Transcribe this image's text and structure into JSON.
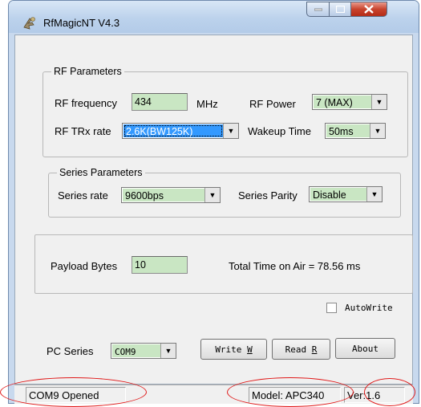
{
  "window": {
    "title": "RfMagicNT V4.3"
  },
  "rf_parameters": {
    "legend": "RF Parameters",
    "rf_frequency_label": "RF frequency",
    "rf_frequency_value": "434",
    "rf_frequency_unit": "MHz",
    "rf_power_label": "RF Power",
    "rf_power_value": "7 (MAX)",
    "rf_trx_rate_label": "RF TRx rate",
    "rf_trx_rate_value": "2.6K(BW125K)",
    "wakeup_time_label": "Wakeup Time",
    "wakeup_time_value": "50ms"
  },
  "series_parameters": {
    "legend": "Series  Parameters",
    "series_rate_label": "Series rate",
    "series_rate_value": "9600bps",
    "series_parity_label": "Series Parity",
    "series_parity_value": "Disable"
  },
  "payload": {
    "label": "Payload Bytes",
    "value": "10",
    "time_on_air": "Total Time on Air  =  78.56 ms"
  },
  "autowrite_label": "AutoWrite",
  "pc_series": {
    "label": "PC  Series",
    "value": "COM9"
  },
  "buttons": {
    "write": "Write",
    "write_key": "W",
    "read": "Read",
    "read_key": "R",
    "about": "About"
  },
  "status": {
    "port": "COM9 Opened",
    "model": "Model: APC340",
    "version": "Ver:1.6"
  },
  "colors": {
    "field_bg": "#c9e6c3",
    "selection": "#3399ff",
    "annotation": "#e01a1a"
  }
}
